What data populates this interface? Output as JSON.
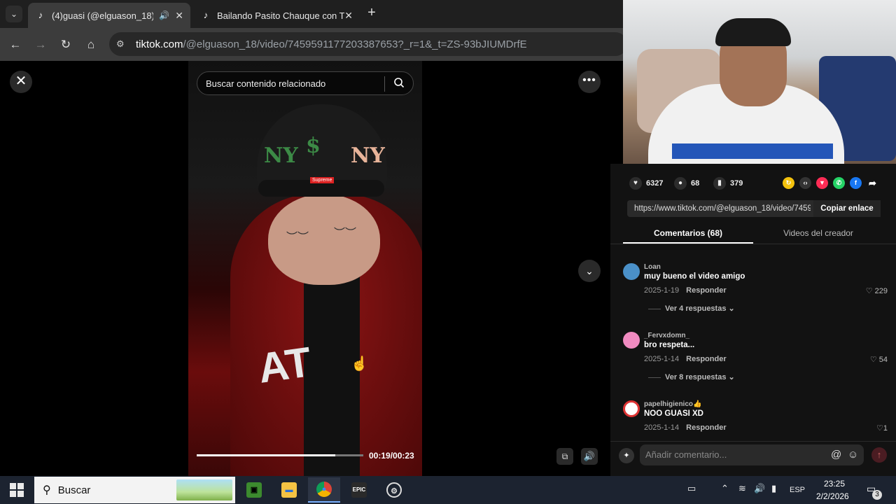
{
  "browser": {
    "tabs": [
      {
        "title": "(4)guasi (@elguason_18) | T",
        "active": true,
        "audio": true
      },
      {
        "title": "Bailando Pasito Chauque con T",
        "active": false,
        "audio": false
      }
    ],
    "url_domain": "tiktok.com",
    "url_path": "/@elguason_18/video/7459591177203387653?_r=1&_t=ZS-93bJIUMDrfE"
  },
  "video": {
    "search_placeholder": "Buscar contenido relacionado",
    "time": "00:19/00:23",
    "progress": 0.83,
    "overlay_text": "Supreme"
  },
  "stats": {
    "likes": "6327",
    "comments": "68",
    "saves": "379"
  },
  "share": {
    "link": "https://www.tiktok.com/@elguason_18/video/7459...",
    "copy_label": "Copiar enlace"
  },
  "panel_tabs": {
    "comments": "Comentarios (68)",
    "creator": "Videos del creador"
  },
  "comments": [
    {
      "user": "Loan",
      "text": "muy bueno el video amigo",
      "date": "2025-1-19",
      "reply": "Responder",
      "likes": "229",
      "replies": "Ver 4 respuestas",
      "avatar_color": "#4a90c8"
    },
    {
      "user": "_Fervxdomn_",
      "text": "bro respeta...",
      "date": "2025-1-14",
      "reply": "Responder",
      "likes": "54",
      "replies": "Ver 8 respuestas",
      "avatar_color": "#f08ac0"
    },
    {
      "user": "papelhigienico👍",
      "text": "NOO GUASI XD",
      "date": "2025-1-14",
      "reply": "Responder",
      "likes": "1",
      "replies": "",
      "avatar_color": "#d33"
    }
  ],
  "comment_input": {
    "placeholder": "Añadir comentario..."
  },
  "taskbar": {
    "search_label": "Buscar",
    "lang": "ESP",
    "time": "23:25",
    "date": "2/2/2026",
    "notifications": "3"
  },
  "colors": {
    "accent_red": "#fe2c55",
    "panel_bg": "#121212"
  }
}
